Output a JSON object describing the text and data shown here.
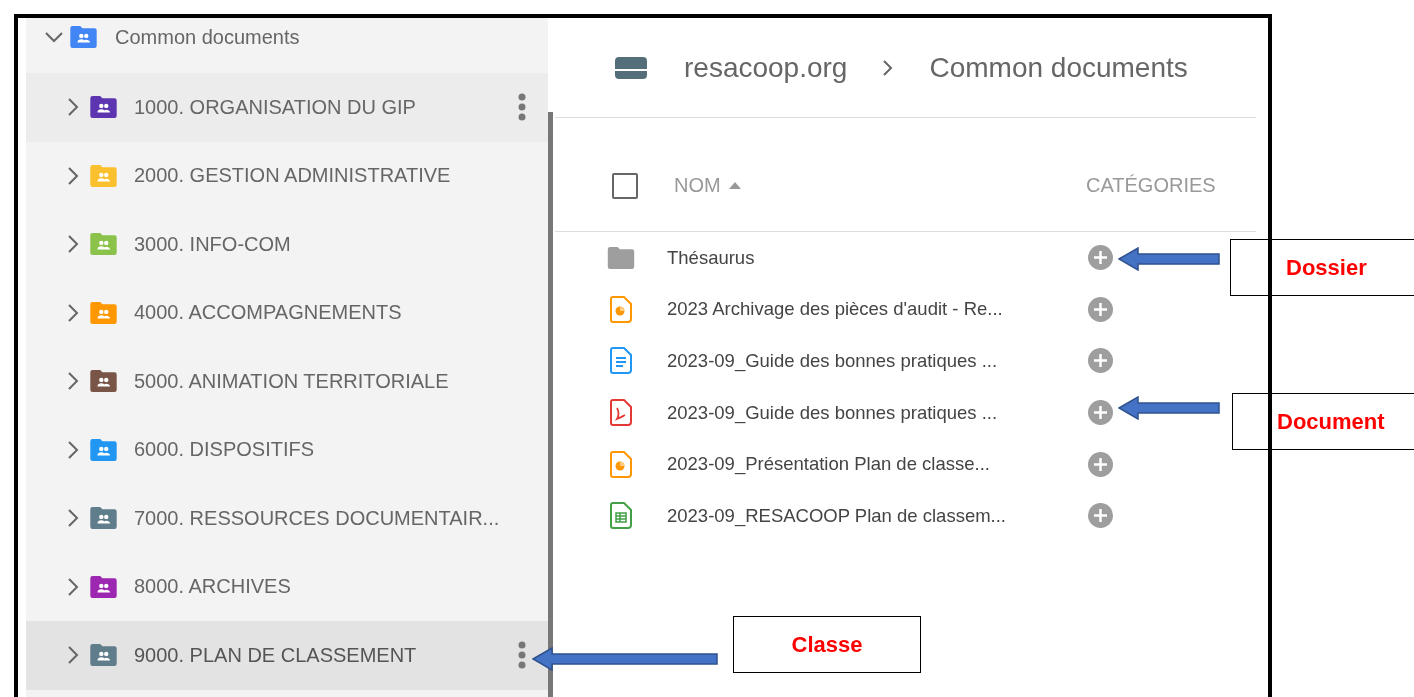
{
  "tree": {
    "root": {
      "label": "Common documents",
      "color": "#4285f4",
      "expanded": true,
      "children": [
        {
          "label": "1000. ORGANISATION DU GIP",
          "color": "#5e35b1",
          "expanded": false,
          "hovered": true,
          "selected": false
        },
        {
          "label": "2000. GESTION ADMINISTRATIVE",
          "color": "#fbc02d",
          "expanded": false,
          "hovered": false,
          "selected": false
        },
        {
          "label": "3000. INFO-COM",
          "color": "#8bc34a",
          "expanded": false,
          "hovered": false,
          "selected": false
        },
        {
          "label": "4000. ACCOMPAGNEMENTS",
          "color": "#ff9800",
          "expanded": false,
          "hovered": false,
          "selected": false
        },
        {
          "label": "5000. ANIMATION TERRITORIALE",
          "color": "#795548",
          "expanded": false,
          "hovered": false,
          "selected": false
        },
        {
          "label": "6000. DISPOSITIFS",
          "color": "#2196f3",
          "expanded": false,
          "hovered": false,
          "selected": false
        },
        {
          "label": "7000. RESSOURCES DOCUMENTAIR...",
          "color": "#607d8b",
          "expanded": false,
          "hovered": false,
          "selected": false
        },
        {
          "label": "8000. ARCHIVES",
          "color": "#9c27b0",
          "expanded": false,
          "hovered": false,
          "selected": false
        },
        {
          "label": "9000. PLAN DE CLASSEMENT",
          "color": "#607d8b",
          "expanded": false,
          "hovered": false,
          "selected": true
        }
      ]
    }
  },
  "breadcrumb": [
    "resacoop.org",
    "Common documents"
  ],
  "table": {
    "select_all": {
      "checked": false
    },
    "columns": [
      {
        "label": "NOM",
        "sorted": true
      },
      {
        "label": "CATÉGORIES",
        "sorted": false
      }
    ],
    "rows": [
      {
        "name": "Thésaurus",
        "kind": "folder"
      },
      {
        "name": "2023 Archivage des pièces d'audit - Re...",
        "kind": "slides"
      },
      {
        "name": "2023-09_Guide des bonnes pratiques ...",
        "kind": "doc"
      },
      {
        "name": "2023-09_Guide des bonnes pratiques ...",
        "kind": "pdf"
      },
      {
        "name": "2023-09_Présentation Plan de classe...",
        "kind": "slides"
      },
      {
        "name": "2023-09_RESACOOP Plan de classem...",
        "kind": "sheet"
      }
    ]
  },
  "annotations": [
    {
      "label": "Dossier"
    },
    {
      "label": "Document"
    },
    {
      "label": "Classe"
    }
  ]
}
